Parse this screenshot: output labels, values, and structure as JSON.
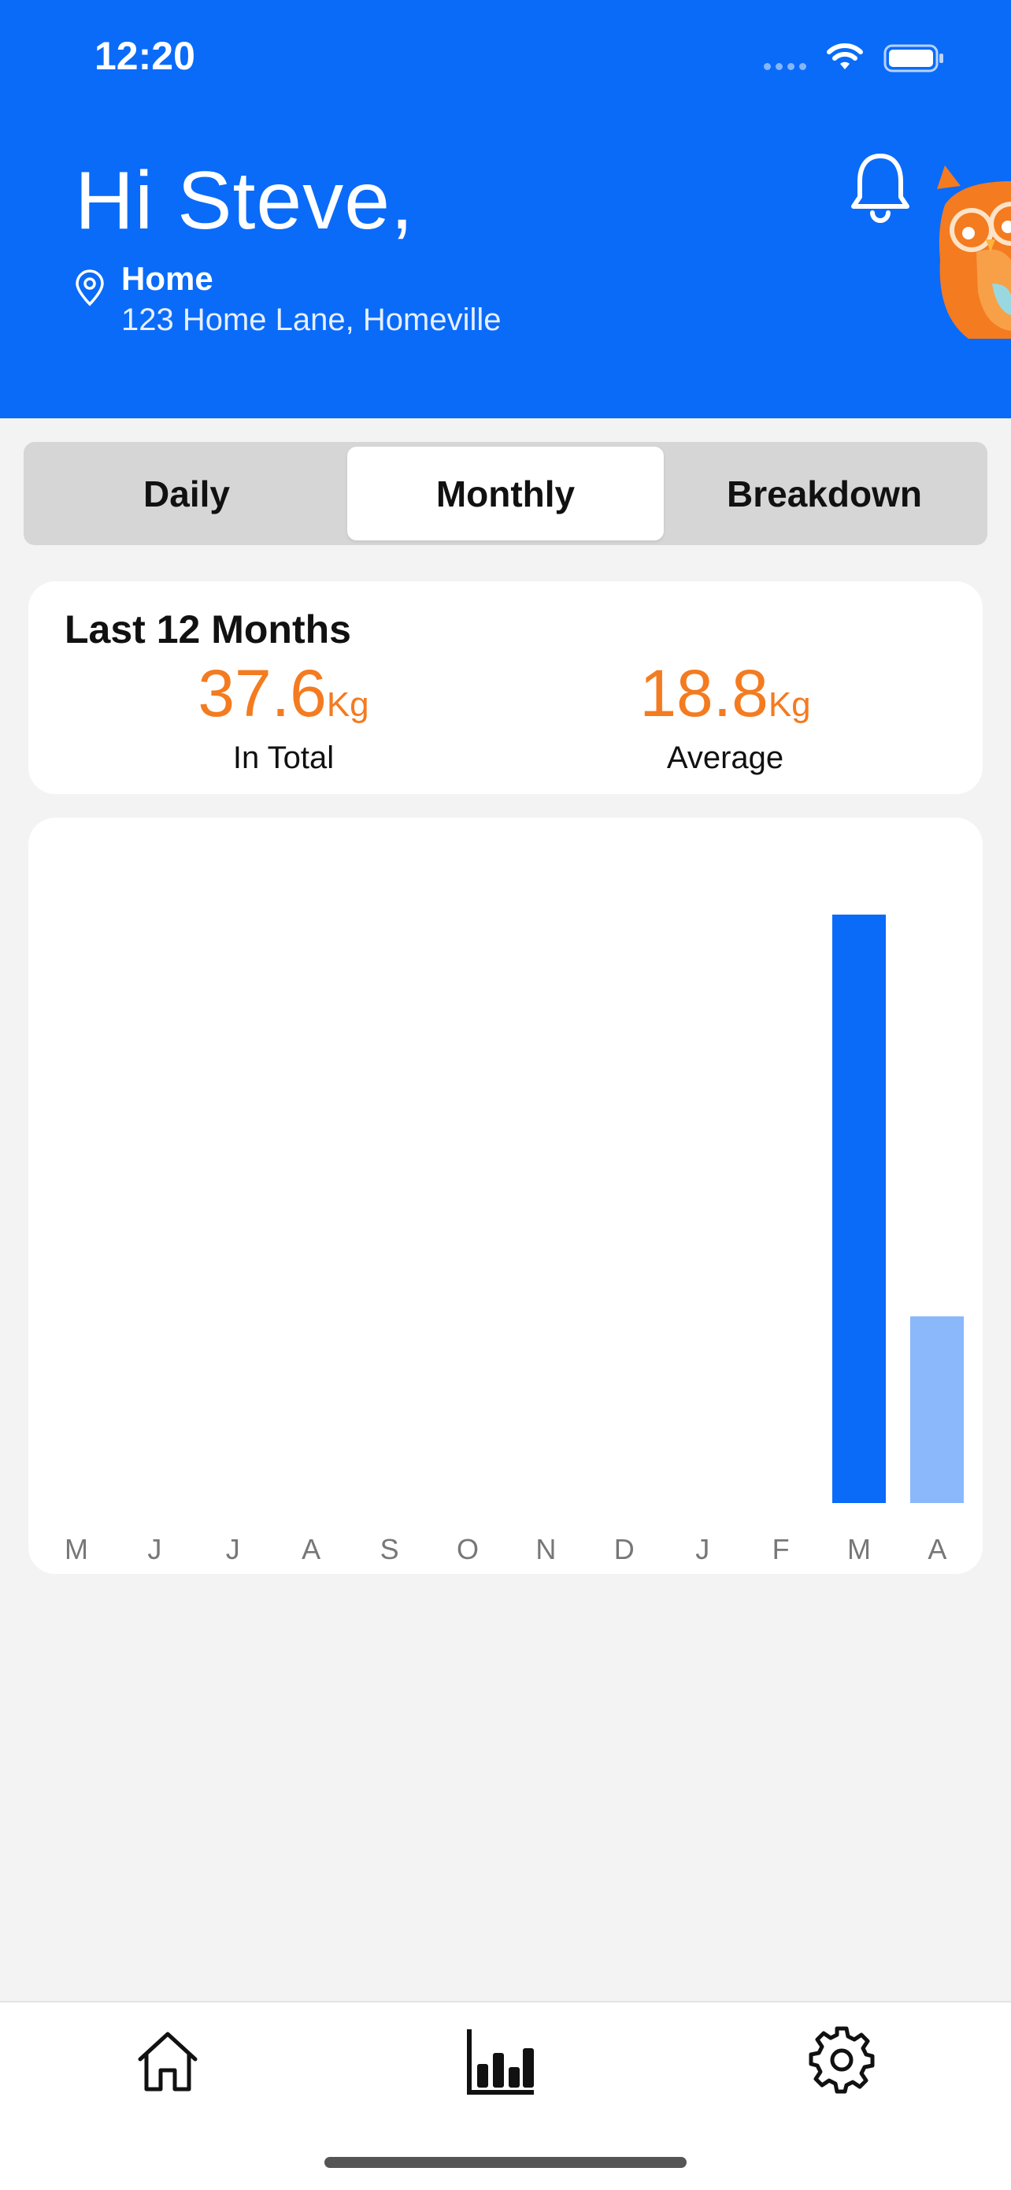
{
  "status_bar": {
    "time": "12:20"
  },
  "header": {
    "greeting": "Hi Steve,",
    "location_name": "Home",
    "location_address": "123 Home Lane, Homeville"
  },
  "segments": [
    {
      "label": "Daily",
      "active": false
    },
    {
      "label": "Monthly",
      "active": true
    },
    {
      "label": "Breakdown",
      "active": false
    }
  ],
  "summary": {
    "title": "Last 12 Months",
    "total_value": "37.6",
    "total_unit": "Kg",
    "total_label": "In Total",
    "average_value": "18.8",
    "average_unit": "Kg",
    "average_label": "Average"
  },
  "chart_data": {
    "type": "bar",
    "categories": [
      "M",
      "J",
      "J",
      "A",
      "S",
      "O",
      "N",
      "D",
      "J",
      "F",
      "M",
      "A"
    ],
    "values": [
      0,
      0,
      0,
      0,
      0,
      0,
      0,
      0,
      0,
      0,
      25.8,
      8.2
    ],
    "ylim": [
      0,
      27
    ],
    "colors": [
      "#0a6bf8",
      "#0a6bf8",
      "#0a6bf8",
      "#0a6bf8",
      "#0a6bf8",
      "#0a6bf8",
      "#0a6bf8",
      "#0a6bf8",
      "#0a6bf8",
      "#0a6bf8",
      "#0a6bf8",
      "#8ab8fb"
    ],
    "grid": false,
    "title": "",
    "xlabel": "",
    "ylabel": ""
  },
  "tab_bar": [
    {
      "icon": "home-icon",
      "active": false
    },
    {
      "icon": "bar-chart-icon",
      "active": true
    },
    {
      "icon": "gear-icon",
      "active": false
    }
  ],
  "colors": {
    "primary": "#0a6bf8",
    "accent": "#f47b20",
    "bar_light": "#8ab8fb"
  }
}
